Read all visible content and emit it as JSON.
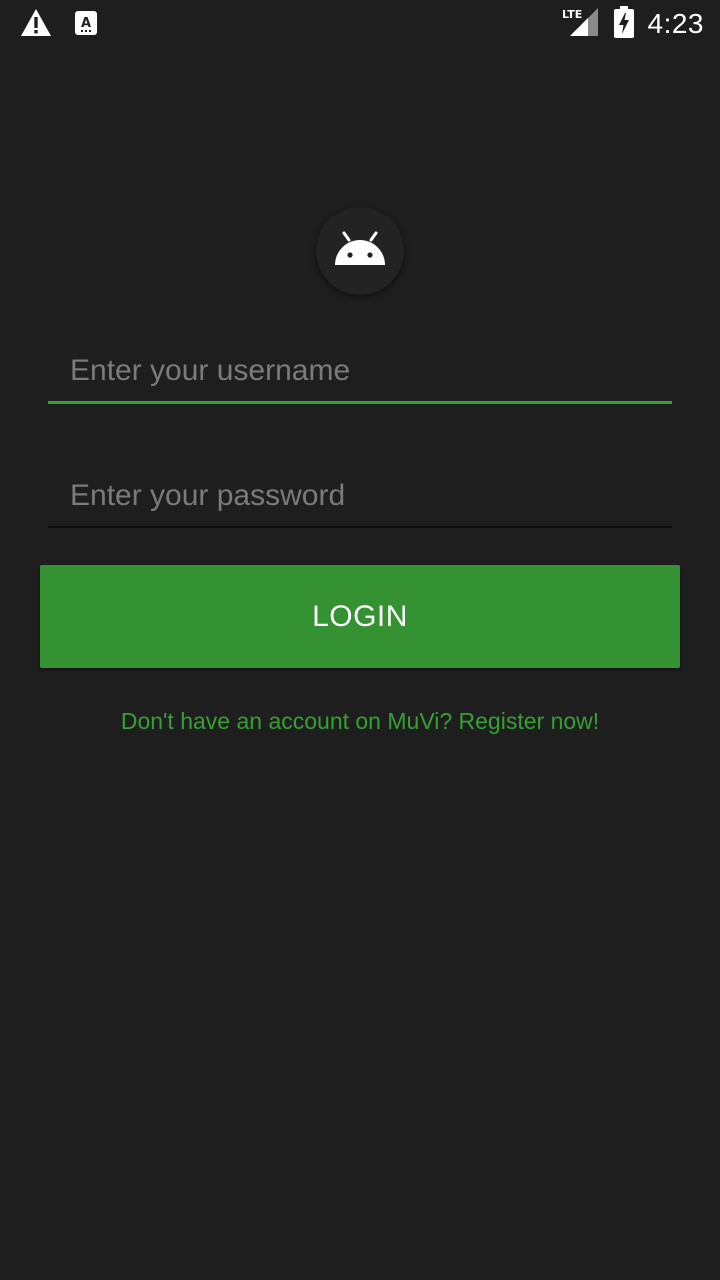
{
  "status_bar": {
    "time": "4:23",
    "network": "LTE",
    "icons": [
      "warning-icon",
      "keyboard-a-icon",
      "lte-signal-icon",
      "battery-charging-icon"
    ]
  },
  "logo": {
    "icon": "android-icon"
  },
  "form": {
    "username_placeholder": "Enter your username",
    "password_placeholder": "Enter your password",
    "login_label": "LOGIN"
  },
  "register_link": "Don't have an account on MuVi? Register now!",
  "colors": {
    "background": "#1e1e1e",
    "accent": "#349232",
    "link": "#35a033"
  }
}
